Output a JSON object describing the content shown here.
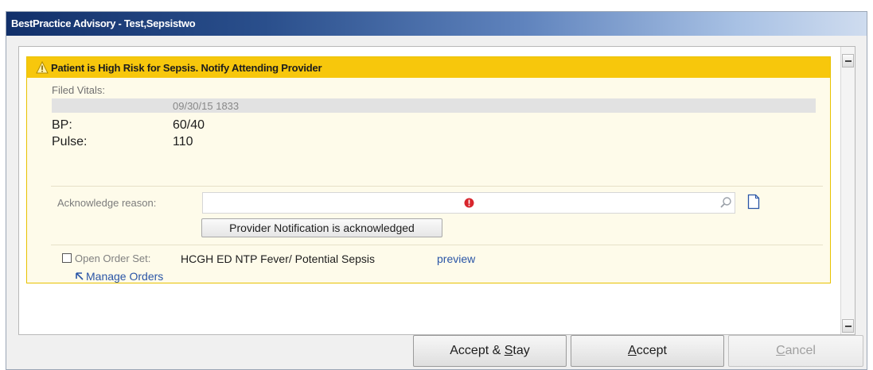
{
  "window": {
    "title": "BestPractice Advisory - Test,Sepsistwo"
  },
  "advisory": {
    "title": "Patient is High Risk for Sepsis. Notify Attending Provider",
    "header_color": "#f7c70c",
    "filed_vitals_label": "Filed Vitals:",
    "timestamp": "09/30/15 1833",
    "vitals": [
      {
        "label": "BP:",
        "value": "60/40"
      },
      {
        "label": "Pulse:",
        "value": "110"
      }
    ],
    "acknowledge": {
      "label": "Acknowledge reason:",
      "value": "",
      "button_label": "Provider Notification is acknowledged"
    },
    "order_set": {
      "checkbox_label": "Open Order Set:",
      "name": "HCGH ED NTP Fever/ Potential Sepsis",
      "preview_label": "preview",
      "checked": false
    },
    "manage_orders_label": "Manage Orders"
  },
  "footer": {
    "accept_stay": {
      "prefix": "Accept & ",
      "underlined": "S",
      "suffix": "tay"
    },
    "accept": {
      "prefix": "",
      "underlined": "A",
      "suffix": "ccept"
    },
    "cancel": {
      "prefix": "",
      "underlined": "C",
      "suffix": "ancel",
      "disabled": true
    }
  },
  "icons": {
    "warning": "warning-icon",
    "required": "required-icon",
    "search": "search-icon",
    "document": "document-icon",
    "manage": "manage-orders-icon"
  }
}
